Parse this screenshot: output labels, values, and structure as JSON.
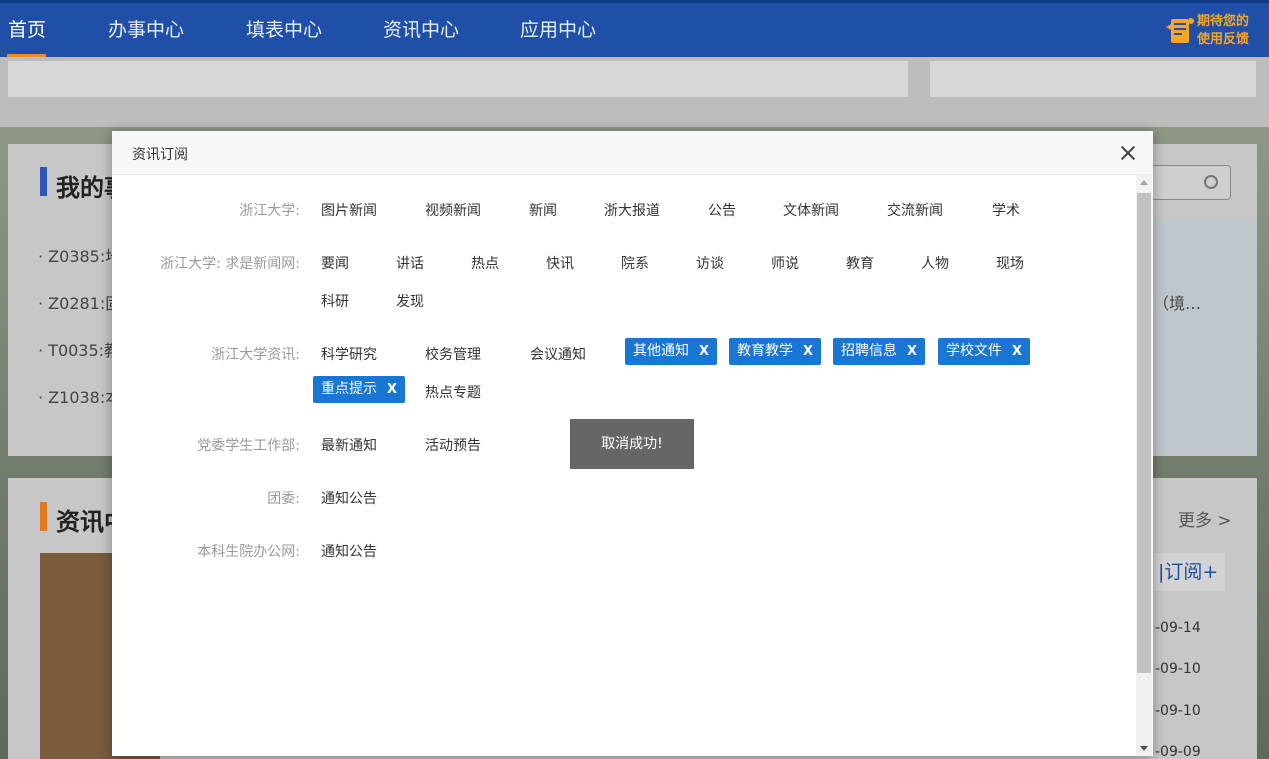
{
  "nav": {
    "items": [
      "首页",
      "办事中心",
      "填表中心",
      "资讯中心",
      "应用中心"
    ],
    "active_index": 0,
    "feedback_line1": "期待您的",
    "feedback_line2": "使用反馈"
  },
  "background": {
    "card1_heading": "我的事",
    "card1_items": [
      "· Z0385:地",
      "· Z0281:固",
      "· T0035:教",
      "· Z1038:本"
    ],
    "card1_right_text": "（境…",
    "card2_heading": "资讯中",
    "more": "更多 >",
    "subscribe": "|订阅+",
    "dates": [
      "-09-14",
      "-09-10",
      "-09-10",
      "-09-09"
    ]
  },
  "modal": {
    "title": "资讯订阅",
    "toast": "取消成功!",
    "rows": [
      {
        "label": "浙江大学:",
        "options": [
          "图片新闻",
          "视频新闻",
          "新闻",
          "浙大报道",
          "公告",
          "文体新闻",
          "交流新闻",
          "学术"
        ]
      },
      {
        "label": "浙江大学: 求是新闻网:",
        "options": [
          "要闻",
          "讲话",
          "热点",
          "快讯",
          "院系",
          "访谈",
          "师说",
          "教育",
          "人物",
          "现场",
          "科研",
          "发现"
        ]
      },
      {
        "label": "浙江大学资讯:",
        "options": [
          "科学研究",
          "校务管理",
          "会议通知",
          "热点专题"
        ],
        "selected": [
          "其他通知",
          "教育教学",
          "招聘信息",
          "学校文件",
          "重点提示"
        ]
      },
      {
        "label": "党委学生工作部:",
        "options": [
          "最新通知",
          "活动预告"
        ]
      },
      {
        "label": "团委:",
        "options": [
          "通知公告"
        ]
      },
      {
        "label": "本科生院办公网:",
        "options": [
          "通知公告"
        ]
      }
    ],
    "remove_glyph": "X"
  },
  "colors": {
    "nav_bg": "#1f4fa6",
    "accent": "#f08a24",
    "tag_bg": "#1976d2",
    "toast_bg": "#666666"
  }
}
